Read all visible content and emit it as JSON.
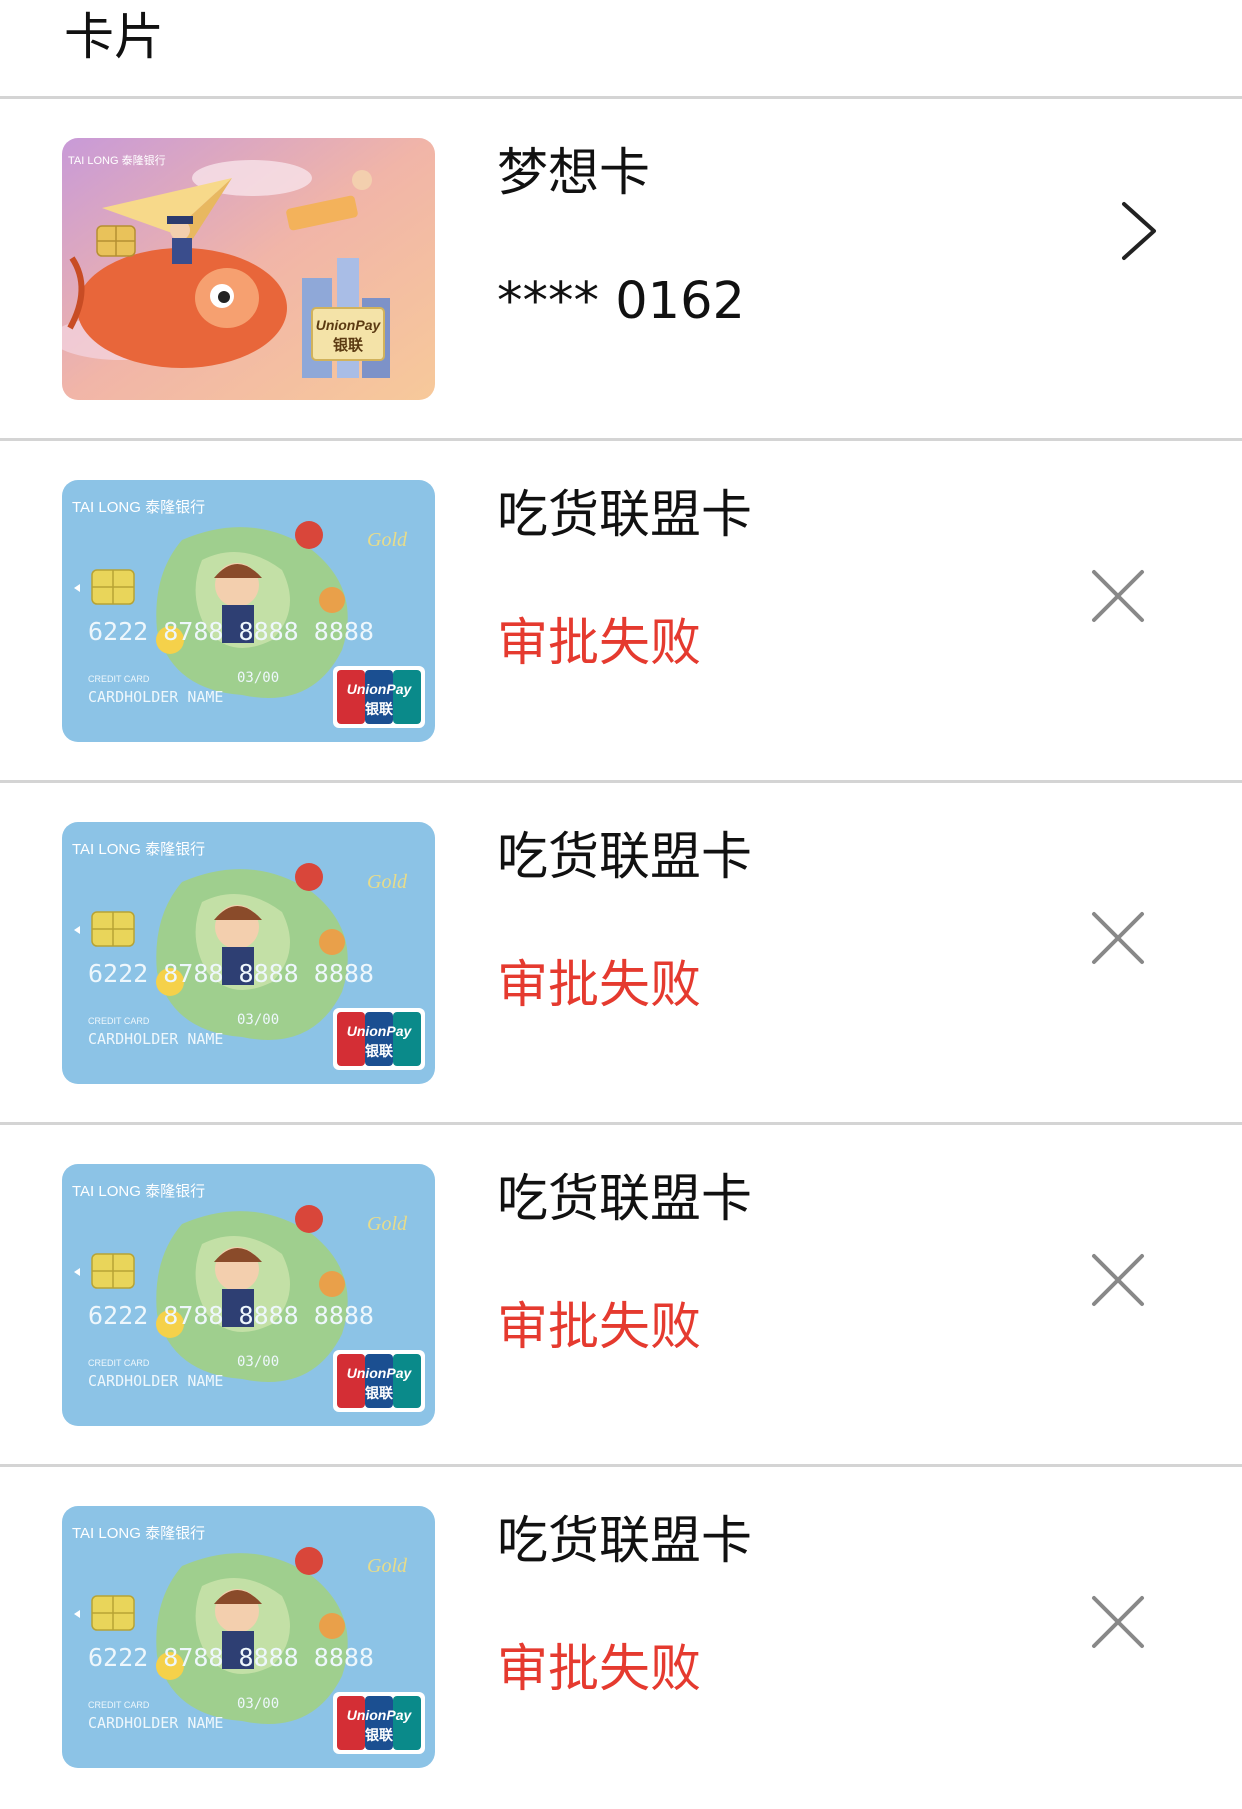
{
  "header": {
    "title": "卡片"
  },
  "cards": [
    {
      "name": "梦想卡",
      "subtitle": "**** 0162",
      "status": "active",
      "action_icon": "chevron-right-icon",
      "art": {
        "bank": "TAI LONG 泰隆银行",
        "network": "UnionPay 银联",
        "theme": "dream"
      }
    },
    {
      "name": "吃货联盟卡",
      "subtitle": "审批失败",
      "status": "failed",
      "action_icon": "close-icon",
      "art": {
        "bank": "TAI LONG 泰隆银行",
        "number": "6222 8788 8888 8888",
        "holder": "CARDHOLDER NAME",
        "valid": "03/00",
        "kind": "CREDIT CARD",
        "network": "UnionPay 银联",
        "theme": "foodie"
      }
    },
    {
      "name": "吃货联盟卡",
      "subtitle": "审批失败",
      "status": "failed",
      "action_icon": "close-icon",
      "art": {
        "bank": "TAI LONG 泰隆银行",
        "number": "6222 8788 8888 8888",
        "holder": "CARDHOLDER NAME",
        "valid": "03/00",
        "kind": "CREDIT CARD",
        "network": "UnionPay 银联",
        "theme": "foodie"
      }
    },
    {
      "name": "吃货联盟卡",
      "subtitle": "审批失败",
      "status": "failed",
      "action_icon": "close-icon",
      "art": {
        "bank": "TAI LONG 泰隆银行",
        "number": "6222 8788 8888 8888",
        "holder": "CARDHOLDER NAME",
        "valid": "03/00",
        "kind": "CREDIT CARD",
        "network": "UnionPay 银联",
        "theme": "foodie"
      }
    },
    {
      "name": "吃货联盟卡",
      "subtitle": "审批失败",
      "status": "failed",
      "action_icon": "close-icon",
      "art": {
        "bank": "TAI LONG 泰隆银行",
        "number": "6222 8788 8888 8888",
        "holder": "CARDHOLDER NAME",
        "valid": "03/00",
        "kind": "CREDIT CARD",
        "network": "UnionPay 银联",
        "theme": "foodie"
      }
    }
  ],
  "colors": {
    "failed_text": "#e53a2f",
    "divider": "#d4d4d4",
    "foodie_card_bg": "#8cc3e6",
    "dream_card_bg": "#e9a0a0"
  }
}
